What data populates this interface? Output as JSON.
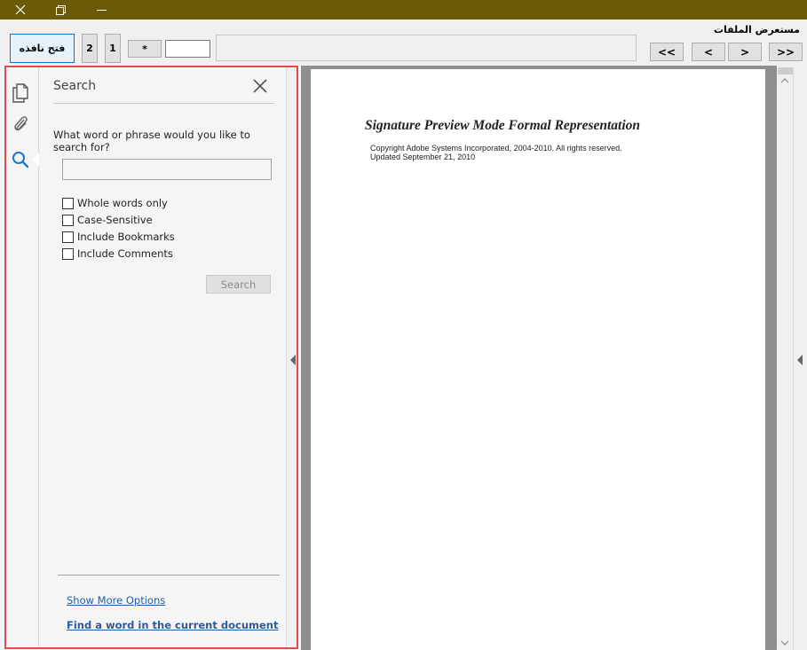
{
  "app": {
    "title": "مستعرض الملفات"
  },
  "toolbar": {
    "open_window_label": "فتح نافذه",
    "page2_label": "2",
    "page1_label": "1",
    "star_label": "*",
    "page_input_value": "",
    "path_value": "",
    "nav_first_label": "<<",
    "nav_prev_label": "<",
    "nav_next_label": ">",
    "nav_last_label": ">>"
  },
  "sidebar": {
    "icons": [
      "pages-icon",
      "attachment-icon",
      "search-icon"
    ],
    "active": "search-icon"
  },
  "search_panel": {
    "title": "Search",
    "prompt": "What word or phrase would you like to search for?",
    "query_value": "",
    "options": [
      {
        "label": "Whole words only",
        "checked": false
      },
      {
        "label": "Case-Sensitive",
        "checked": false
      },
      {
        "label": "Include Bookmarks",
        "checked": false
      },
      {
        "label": "Include Comments",
        "checked": false
      }
    ],
    "search_button_label": "Search",
    "more_options_link": "Show More Options",
    "find_link": "Find a word in the current document"
  },
  "document": {
    "title": "Signature Preview Mode Formal Representation",
    "line1": "Copyright Adobe Systems Incorporated, 2004-2010.  All rights reserved.",
    "line2": "Updated September 21, 2010"
  },
  "colors": {
    "titlebar": "#6b5a07",
    "highlight_frame": "#e34b4b",
    "link": "#1f5fa8",
    "accent_search_icon": "#1e78c8"
  }
}
